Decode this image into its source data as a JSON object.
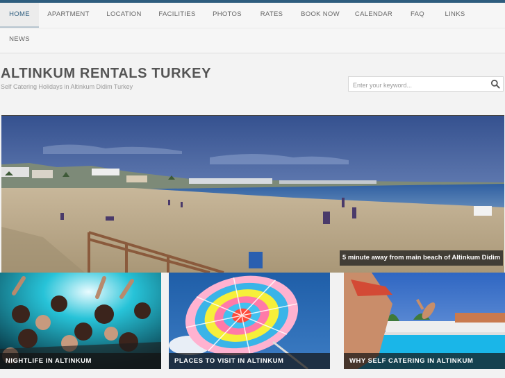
{
  "nav": {
    "items": [
      {
        "label": "HOME",
        "active": true
      },
      {
        "label": "APARTMENT"
      },
      {
        "label": "LOCATION"
      },
      {
        "label": "FACILITIES"
      },
      {
        "label": "PHOTOS"
      },
      {
        "label": "RATES"
      },
      {
        "label": "BOOK NOW"
      },
      {
        "label": "CALENDAR"
      },
      {
        "label": "FAQ"
      },
      {
        "label": "LINKS"
      }
    ],
    "row2": [
      {
        "label": "NEWS"
      }
    ]
  },
  "site": {
    "title": "ALTINKUM RENTALS TURKEY",
    "tagline": "Self Catering Holidays in Altinkum Didim Turkey"
  },
  "search": {
    "placeholder": "Enter your keyword...",
    "icon": "search-icon"
  },
  "hero": {
    "caption": "5 minute away from main beach of Altinkum Didim"
  },
  "tiles": [
    {
      "label": "NIGHTLIFE IN ALTINKUM"
    },
    {
      "label": "PLACES TO VISIT IN ALTINKUM"
    },
    {
      "label": "WHY SELF CATERING IN ALTINKUM"
    }
  ],
  "colors": {
    "accent": "#2e5d7e",
    "nav_text": "#666666",
    "title": "#555555"
  }
}
